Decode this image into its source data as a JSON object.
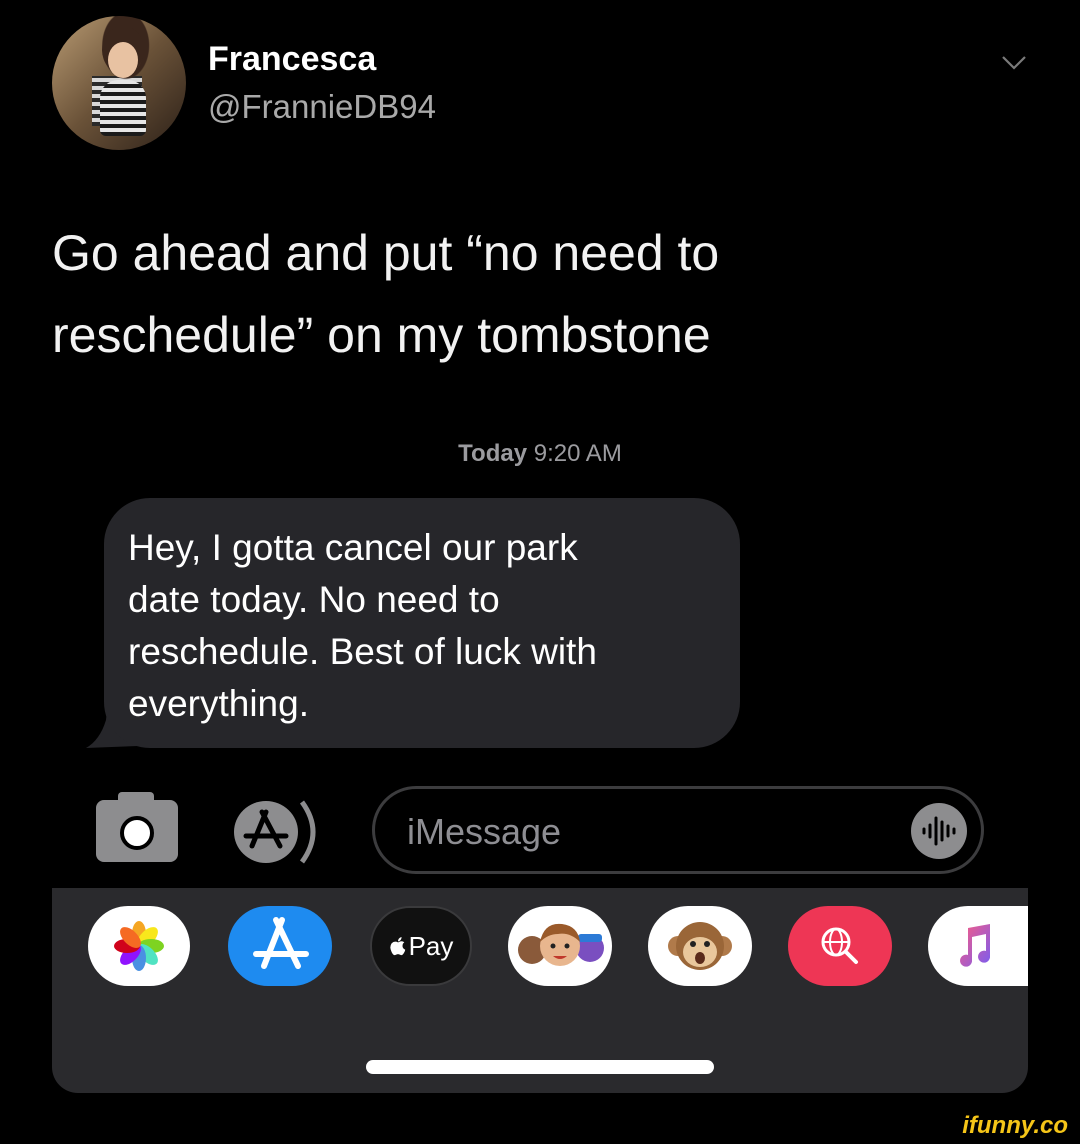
{
  "tweet": {
    "author_name": "Francesca",
    "author_handle": "@FrannieDB94",
    "text_line1": "Go ahead and put “no need to",
    "text_line2": "reschedule” on my tombstone"
  },
  "conversation": {
    "timestamp_day": "Today",
    "timestamp_time": "9:20 AM",
    "message_lines": [
      "Hey, I gotta cancel our park",
      "date today. No need to",
      "reschedule. Best of luck with",
      "everything."
    ]
  },
  "compose": {
    "placeholder": "iMessage"
  },
  "app_drawer": {
    "apple_pay_label": "Pay",
    "apps": [
      "photos-app",
      "app-store-app",
      "apple-pay-app",
      "memoji-app",
      "animoji-app",
      "web-images-app",
      "music-app"
    ]
  },
  "watermark": "ifunny.co",
  "colors": {
    "background": "#000000",
    "bubble": "#26262a",
    "drawer": "#2a2a2d",
    "app_store_blue": "#1e8bf0",
    "web_search_red": "#ee3655"
  }
}
